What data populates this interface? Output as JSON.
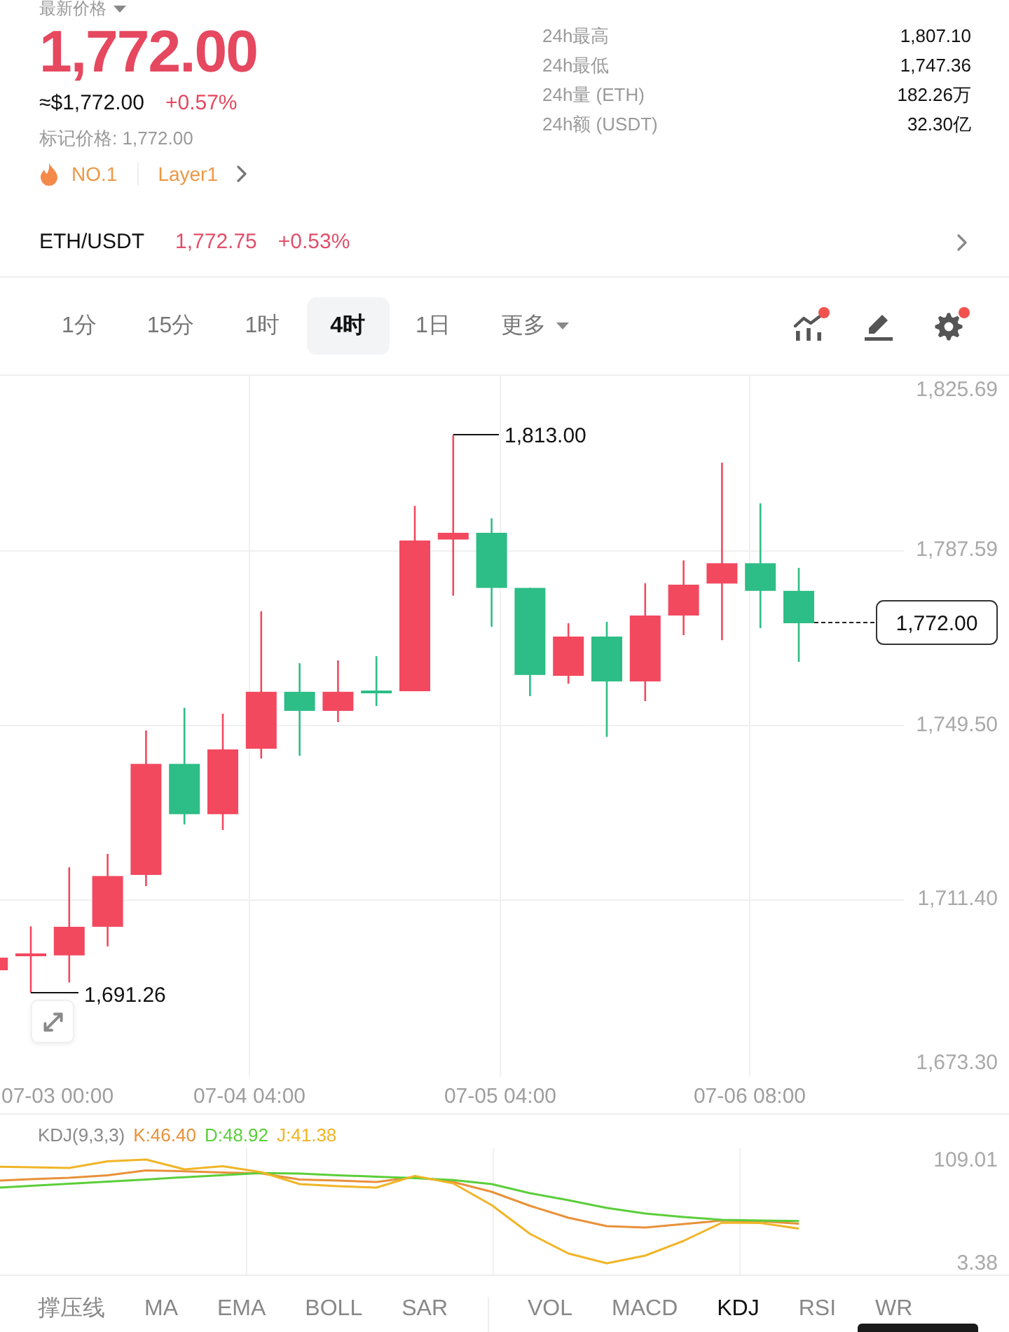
{
  "header": {
    "label": "最新价格",
    "price": "1,772.00",
    "usd_price": "≈$1,772.00",
    "change": "+0.57%",
    "mark_price": "标记价格: 1,772.00",
    "tags": [
      {
        "kind": "rank",
        "text": "NO.1"
      },
      {
        "kind": "sector",
        "text": "Layer1"
      }
    ]
  },
  "stats": [
    {
      "label": "24h最高",
      "value": "1,807.10"
    },
    {
      "label": "24h最低",
      "value": "1,747.36"
    },
    {
      "label": "24h量 (ETH)",
      "value": "182.26万"
    },
    {
      "label": "24h额 (USDT)",
      "value": "32.30亿"
    }
  ],
  "pair_row": {
    "pair": "ETH/USDT",
    "price": "1,772.75",
    "change": "+0.53%"
  },
  "timeframes": [
    {
      "kind": "interval",
      "label": "1分",
      "selected": false
    },
    {
      "kind": "interval",
      "label": "15分",
      "selected": false
    },
    {
      "kind": "interval",
      "label": "1时",
      "selected": false
    },
    {
      "kind": "interval",
      "label": "4时",
      "selected": true
    },
    {
      "kind": "interval",
      "label": "1日",
      "selected": false
    },
    {
      "kind": "dropdown",
      "label": "更多",
      "selected": false
    }
  ],
  "toolbar": [
    {
      "kind": "indicators",
      "dot": true
    },
    {
      "kind": "drawing",
      "dot": false
    },
    {
      "kind": "settings",
      "dot": true
    }
  ],
  "price_chart": {
    "y_labels": [
      "1,825.69",
      "1,787.59",
      "1,749.50",
      "1,711.40",
      "1,673.30"
    ],
    "x_labels": [
      "07-03 00:00",
      "07-04 04:00",
      "07-05 04:00",
      "07-06 08:00"
    ],
    "high_label": "1,813.00",
    "low_label": "1,691.26",
    "last_price": "1,772.00"
  },
  "indicator_pane": {
    "title": "KDJ(9,3,3)",
    "readings": [
      {
        "text": "K:46.40",
        "color": "#e8913a"
      },
      {
        "text": "D:48.92",
        "color": "#5cce3a"
      },
      {
        "text": "J:41.38",
        "color": "#f0b527"
      }
    ],
    "y_labels": [
      "109.01",
      "3.38"
    ]
  },
  "main_indicators": [
    {
      "label": "撑压线",
      "selected": false
    },
    {
      "label": "MA",
      "selected": false
    },
    {
      "label": "EMA",
      "selected": false
    },
    {
      "label": "BOLL",
      "selected": false
    },
    {
      "label": "SAR",
      "selected": false
    }
  ],
  "sub_indicators": [
    {
      "label": "VOL",
      "selected": false
    },
    {
      "label": "MACD",
      "selected": false
    },
    {
      "label": "KDJ",
      "selected": true
    },
    {
      "label": "RSI",
      "selected": false
    },
    {
      "label": "WR",
      "selected": false
    }
  ]
}
